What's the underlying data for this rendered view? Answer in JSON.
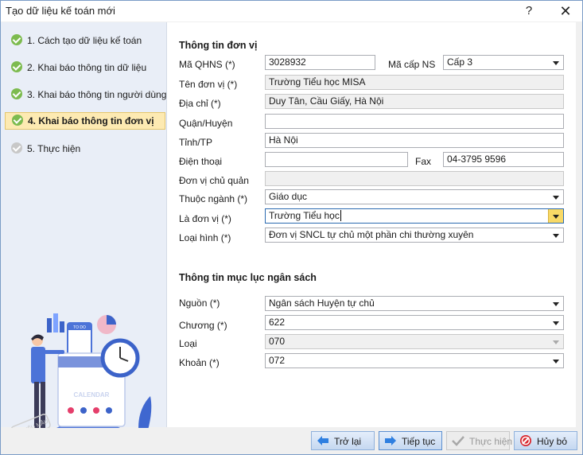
{
  "window": {
    "title": "Tạo dữ liệu kế toán mới",
    "help": "?",
    "close": "✕"
  },
  "steps": [
    {
      "label": "1. Cách tạo dữ liệu kế toán",
      "state": "done"
    },
    {
      "label": "2. Khai báo thông tin dữ liệu",
      "state": "done"
    },
    {
      "label": "3. Khai báo thông tin người dùng",
      "state": "done"
    },
    {
      "label": "4. Khai báo thông tin đơn vị",
      "state": "active"
    },
    {
      "label": "5. Thực hiện",
      "state": "pending"
    }
  ],
  "illustration": {
    "card_text": "TO DO",
    "calendar_text": "CALENDAR",
    "stamp_text": "DỮ LIỆU MẪU"
  },
  "unit": {
    "section_title": "Thông tin đơn vị",
    "ma_qhns": {
      "label": "Mã QHNS (*)",
      "value": "3028932"
    },
    "ma_cap_ns": {
      "label": "Mã cấp NS",
      "value": "Cấp 3"
    },
    "ten_don_vi": {
      "label": "Tên đơn vị (*)",
      "value": "Trường Tiểu học MISA"
    },
    "dia_chi": {
      "label": "Địa chỉ (*)",
      "value": "Duy Tân, Cầu Giấy, Hà Nội"
    },
    "quan_huyen": {
      "label": "Quận/Huyện",
      "value": ""
    },
    "tinh_tp": {
      "label": "Tỉnh/TP",
      "value": "Hà Nội"
    },
    "dien_thoai": {
      "label": "Điện thoại",
      "value": ""
    },
    "fax": {
      "label": "Fax",
      "value": "04-3795 9596"
    },
    "don_vi_chu_quan": {
      "label": "Đơn vị chủ quản",
      "value": ""
    },
    "thuoc_nganh": {
      "label": "Thuộc ngành (*)",
      "value": "Giáo dục"
    },
    "la_don_vi": {
      "label": "Là đơn vị (*)",
      "value": "Trường Tiểu học"
    },
    "loai_hinh": {
      "label": "Loại hình (*)",
      "value": "Đơn vị SNCL tự chủ một phần chi thường xuyên"
    }
  },
  "budget": {
    "section_title": "Thông tin mục lục ngân sách",
    "nguon": {
      "label": "Nguồn (*)",
      "value": "Ngân sách Huyện tự chủ"
    },
    "chuong": {
      "label": "Chương (*)",
      "value": "622"
    },
    "loai": {
      "label": "Loại",
      "value": "070"
    },
    "khoan": {
      "label": "Khoản (*)",
      "value": "072"
    }
  },
  "footer": {
    "back": "Trở lại",
    "next": "Tiếp tục",
    "execute": "Thực hiện",
    "cancel": "Hủy bỏ"
  }
}
